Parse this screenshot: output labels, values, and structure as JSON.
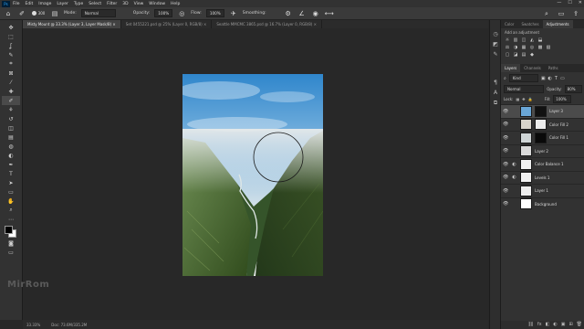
{
  "app": {
    "logo": "Ps"
  },
  "menu": [
    "File",
    "Edit",
    "Image",
    "Layer",
    "Type",
    "Select",
    "Filter",
    "3D",
    "View",
    "Window",
    "Help"
  ],
  "window_controls": [
    "—",
    "☐",
    "✕"
  ],
  "options_bar": {
    "brush_size": "300",
    "mode_label": "Mode:",
    "mode_value": "Normal",
    "opacity_label": "Opacity:",
    "opacity_value": "100%",
    "flow_label": "Flow:",
    "flow_value": "100%",
    "smoothing_label": "Smoothing:"
  },
  "doc_tabs": [
    {
      "label": "Misty Mount @ 33.3% (Layer 3, Layer Mask/8) ×",
      "active": true
    },
    {
      "label": "Set 0455221.psd @ 25% (Layer 0, RGB/8) ×",
      "active": false
    },
    {
      "label": "Seattle MMCMC 3865.psd @ 16.7% (Layer 0, RGB/8) ×",
      "active": false
    }
  ],
  "tools": [
    "move-icon",
    "marquee-icon",
    "lasso-icon",
    "quick-select-icon",
    "crop-icon",
    "frame-icon",
    "eyedropper-icon",
    "healing-icon",
    "brush-icon",
    "clone-stamp-icon",
    "history-brush-icon",
    "eraser-icon",
    "gradient-icon",
    "blur-icon",
    "dodge-icon",
    "pen-icon",
    "type-icon",
    "path-select-icon",
    "rectangle-icon",
    "hand-icon",
    "zoom-icon",
    "more-tools-icon"
  ],
  "tool_glyphs": [
    "✥",
    "⬚",
    "ʆ",
    "✎",
    "⌗",
    "⊠",
    "⁄",
    "✚",
    "✐",
    "⚘",
    "↺",
    "◫",
    "▤",
    "◍",
    "◐",
    "✒",
    "T",
    "➤",
    "▭",
    "✋",
    "⌕",
    "⋯"
  ],
  "canvas": {
    "watermark": "MirRom",
    "colors": {
      "workspace": "#282828",
      "sky_top": "#3a8fd1",
      "sky_bottom": "#cfe2ee",
      "grass": "#3d5d22"
    }
  },
  "status": {
    "zoom": "33.33%",
    "doc": "Doc: 73.6M/335.2M"
  },
  "right_icons": [
    "history-icon",
    "properties-icon",
    "brush-panel-icon",
    "paragraph-icon",
    "character-icon",
    "layer-comps-icon"
  ],
  "right_icon_glyphs": [
    "◷",
    "◩",
    "✎",
    "¶",
    "A",
    "⧉"
  ],
  "adjust_panel": {
    "tabs": [
      "Color",
      "Swatches",
      "Adjustments"
    ],
    "active_tab": 2,
    "title": "Add an adjustment",
    "icons_row1": [
      "☼",
      "▥",
      "◫",
      "◭",
      "⬓"
    ],
    "icons_row2": [
      "⚖",
      "◑",
      "▦",
      "◎",
      "▩",
      "▧"
    ],
    "icons_row3": [
      "▢",
      "◪",
      "▤",
      "◆"
    ]
  },
  "layers_panel": {
    "tabs": [
      "Layers",
      "Channels",
      "Paths"
    ],
    "active_tab": 0,
    "kind_label": "Kind",
    "blend_mode": "Normal",
    "opacity_label": "Opacity:",
    "opacity": "80%",
    "lock_label": "Lock:",
    "fill_label": "Fill:",
    "fill": "100%",
    "layers": [
      {
        "name": "Layer 3",
        "selected": true,
        "thumb": "#6aa6d6",
        "mask": "#111111",
        "adjustment": false
      },
      {
        "name": "Color Fill 2",
        "selected": false,
        "thumb": "#d8d4cc",
        "mask": "#ececec",
        "adjustment": false
      },
      {
        "name": "Color Fill 1",
        "selected": false,
        "thumb": "#cfd5d6",
        "mask": "#0a0a0a",
        "adjustment": false
      },
      {
        "name": "Layer 2",
        "selected": false,
        "thumb": "#d9d9d9",
        "mask": "",
        "adjustment": false
      },
      {
        "name": "Color Balance 1",
        "selected": false,
        "thumb": "#f2f2f2",
        "mask": "",
        "adjustment": true
      },
      {
        "name": "Levels 1",
        "selected": false,
        "thumb": "#f2f2f2",
        "mask": "",
        "adjustment": true
      },
      {
        "name": "Layer 1",
        "selected": false,
        "thumb": "#ededed",
        "mask": "",
        "adjustment": false
      },
      {
        "name": "Background",
        "selected": false,
        "thumb": "#ffffff",
        "mask": "",
        "adjustment": false
      }
    ],
    "bottom_icons": [
      "⛓",
      "fx",
      "◧",
      "◐",
      "▣",
      "⊞",
      "🗑"
    ]
  }
}
